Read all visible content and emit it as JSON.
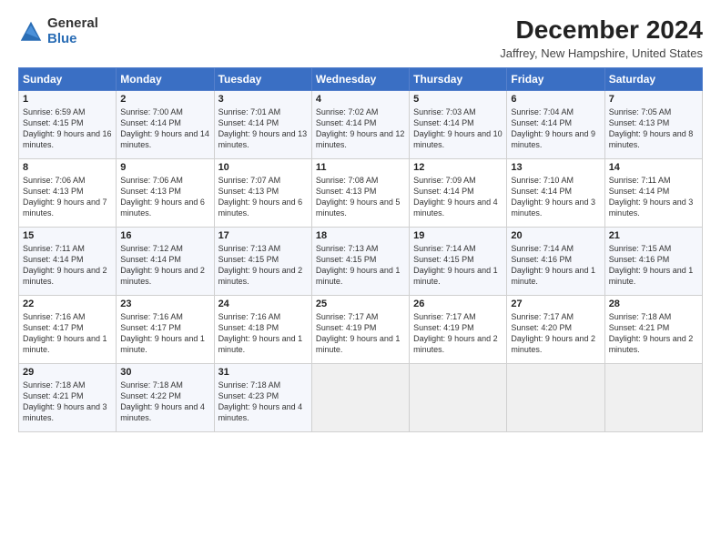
{
  "logo": {
    "general": "General",
    "blue": "Blue"
  },
  "title": "December 2024",
  "location": "Jaffrey, New Hampshire, United States",
  "days_of_week": [
    "Sunday",
    "Monday",
    "Tuesday",
    "Wednesday",
    "Thursday",
    "Friday",
    "Saturday"
  ],
  "weeks": [
    [
      {
        "day": 1,
        "sunrise": "Sunrise: 6:59 AM",
        "sunset": "Sunset: 4:15 PM",
        "daylight": "Daylight: 9 hours and 16 minutes."
      },
      {
        "day": 2,
        "sunrise": "Sunrise: 7:00 AM",
        "sunset": "Sunset: 4:14 PM",
        "daylight": "Daylight: 9 hours and 14 minutes."
      },
      {
        "day": 3,
        "sunrise": "Sunrise: 7:01 AM",
        "sunset": "Sunset: 4:14 PM",
        "daylight": "Daylight: 9 hours and 13 minutes."
      },
      {
        "day": 4,
        "sunrise": "Sunrise: 7:02 AM",
        "sunset": "Sunset: 4:14 PM",
        "daylight": "Daylight: 9 hours and 12 minutes."
      },
      {
        "day": 5,
        "sunrise": "Sunrise: 7:03 AM",
        "sunset": "Sunset: 4:14 PM",
        "daylight": "Daylight: 9 hours and 10 minutes."
      },
      {
        "day": 6,
        "sunrise": "Sunrise: 7:04 AM",
        "sunset": "Sunset: 4:14 PM",
        "daylight": "Daylight: 9 hours and 9 minutes."
      },
      {
        "day": 7,
        "sunrise": "Sunrise: 7:05 AM",
        "sunset": "Sunset: 4:13 PM",
        "daylight": "Daylight: 9 hours and 8 minutes."
      }
    ],
    [
      {
        "day": 8,
        "sunrise": "Sunrise: 7:06 AM",
        "sunset": "Sunset: 4:13 PM",
        "daylight": "Daylight: 9 hours and 7 minutes."
      },
      {
        "day": 9,
        "sunrise": "Sunrise: 7:06 AM",
        "sunset": "Sunset: 4:13 PM",
        "daylight": "Daylight: 9 hours and 6 minutes."
      },
      {
        "day": 10,
        "sunrise": "Sunrise: 7:07 AM",
        "sunset": "Sunset: 4:13 PM",
        "daylight": "Daylight: 9 hours and 6 minutes."
      },
      {
        "day": 11,
        "sunrise": "Sunrise: 7:08 AM",
        "sunset": "Sunset: 4:13 PM",
        "daylight": "Daylight: 9 hours and 5 minutes."
      },
      {
        "day": 12,
        "sunrise": "Sunrise: 7:09 AM",
        "sunset": "Sunset: 4:14 PM",
        "daylight": "Daylight: 9 hours and 4 minutes."
      },
      {
        "day": 13,
        "sunrise": "Sunrise: 7:10 AM",
        "sunset": "Sunset: 4:14 PM",
        "daylight": "Daylight: 9 hours and 3 minutes."
      },
      {
        "day": 14,
        "sunrise": "Sunrise: 7:11 AM",
        "sunset": "Sunset: 4:14 PM",
        "daylight": "Daylight: 9 hours and 3 minutes."
      }
    ],
    [
      {
        "day": 15,
        "sunrise": "Sunrise: 7:11 AM",
        "sunset": "Sunset: 4:14 PM",
        "daylight": "Daylight: 9 hours and 2 minutes."
      },
      {
        "day": 16,
        "sunrise": "Sunrise: 7:12 AM",
        "sunset": "Sunset: 4:14 PM",
        "daylight": "Daylight: 9 hours and 2 minutes."
      },
      {
        "day": 17,
        "sunrise": "Sunrise: 7:13 AM",
        "sunset": "Sunset: 4:15 PM",
        "daylight": "Daylight: 9 hours and 2 minutes."
      },
      {
        "day": 18,
        "sunrise": "Sunrise: 7:13 AM",
        "sunset": "Sunset: 4:15 PM",
        "daylight": "Daylight: 9 hours and 1 minute."
      },
      {
        "day": 19,
        "sunrise": "Sunrise: 7:14 AM",
        "sunset": "Sunset: 4:15 PM",
        "daylight": "Daylight: 9 hours and 1 minute."
      },
      {
        "day": 20,
        "sunrise": "Sunrise: 7:14 AM",
        "sunset": "Sunset: 4:16 PM",
        "daylight": "Daylight: 9 hours and 1 minute."
      },
      {
        "day": 21,
        "sunrise": "Sunrise: 7:15 AM",
        "sunset": "Sunset: 4:16 PM",
        "daylight": "Daylight: 9 hours and 1 minute."
      }
    ],
    [
      {
        "day": 22,
        "sunrise": "Sunrise: 7:16 AM",
        "sunset": "Sunset: 4:17 PM",
        "daylight": "Daylight: 9 hours and 1 minute."
      },
      {
        "day": 23,
        "sunrise": "Sunrise: 7:16 AM",
        "sunset": "Sunset: 4:17 PM",
        "daylight": "Daylight: 9 hours and 1 minute."
      },
      {
        "day": 24,
        "sunrise": "Sunrise: 7:16 AM",
        "sunset": "Sunset: 4:18 PM",
        "daylight": "Daylight: 9 hours and 1 minute."
      },
      {
        "day": 25,
        "sunrise": "Sunrise: 7:17 AM",
        "sunset": "Sunset: 4:19 PM",
        "daylight": "Daylight: 9 hours and 1 minute."
      },
      {
        "day": 26,
        "sunrise": "Sunrise: 7:17 AM",
        "sunset": "Sunset: 4:19 PM",
        "daylight": "Daylight: 9 hours and 2 minutes."
      },
      {
        "day": 27,
        "sunrise": "Sunrise: 7:17 AM",
        "sunset": "Sunset: 4:20 PM",
        "daylight": "Daylight: 9 hours and 2 minutes."
      },
      {
        "day": 28,
        "sunrise": "Sunrise: 7:18 AM",
        "sunset": "Sunset: 4:21 PM",
        "daylight": "Daylight: 9 hours and 2 minutes."
      }
    ],
    [
      {
        "day": 29,
        "sunrise": "Sunrise: 7:18 AM",
        "sunset": "Sunset: 4:21 PM",
        "daylight": "Daylight: 9 hours and 3 minutes."
      },
      {
        "day": 30,
        "sunrise": "Sunrise: 7:18 AM",
        "sunset": "Sunset: 4:22 PM",
        "daylight": "Daylight: 9 hours and 4 minutes."
      },
      {
        "day": 31,
        "sunrise": "Sunrise: 7:18 AM",
        "sunset": "Sunset: 4:23 PM",
        "daylight": "Daylight: 9 hours and 4 minutes."
      },
      null,
      null,
      null,
      null
    ]
  ]
}
